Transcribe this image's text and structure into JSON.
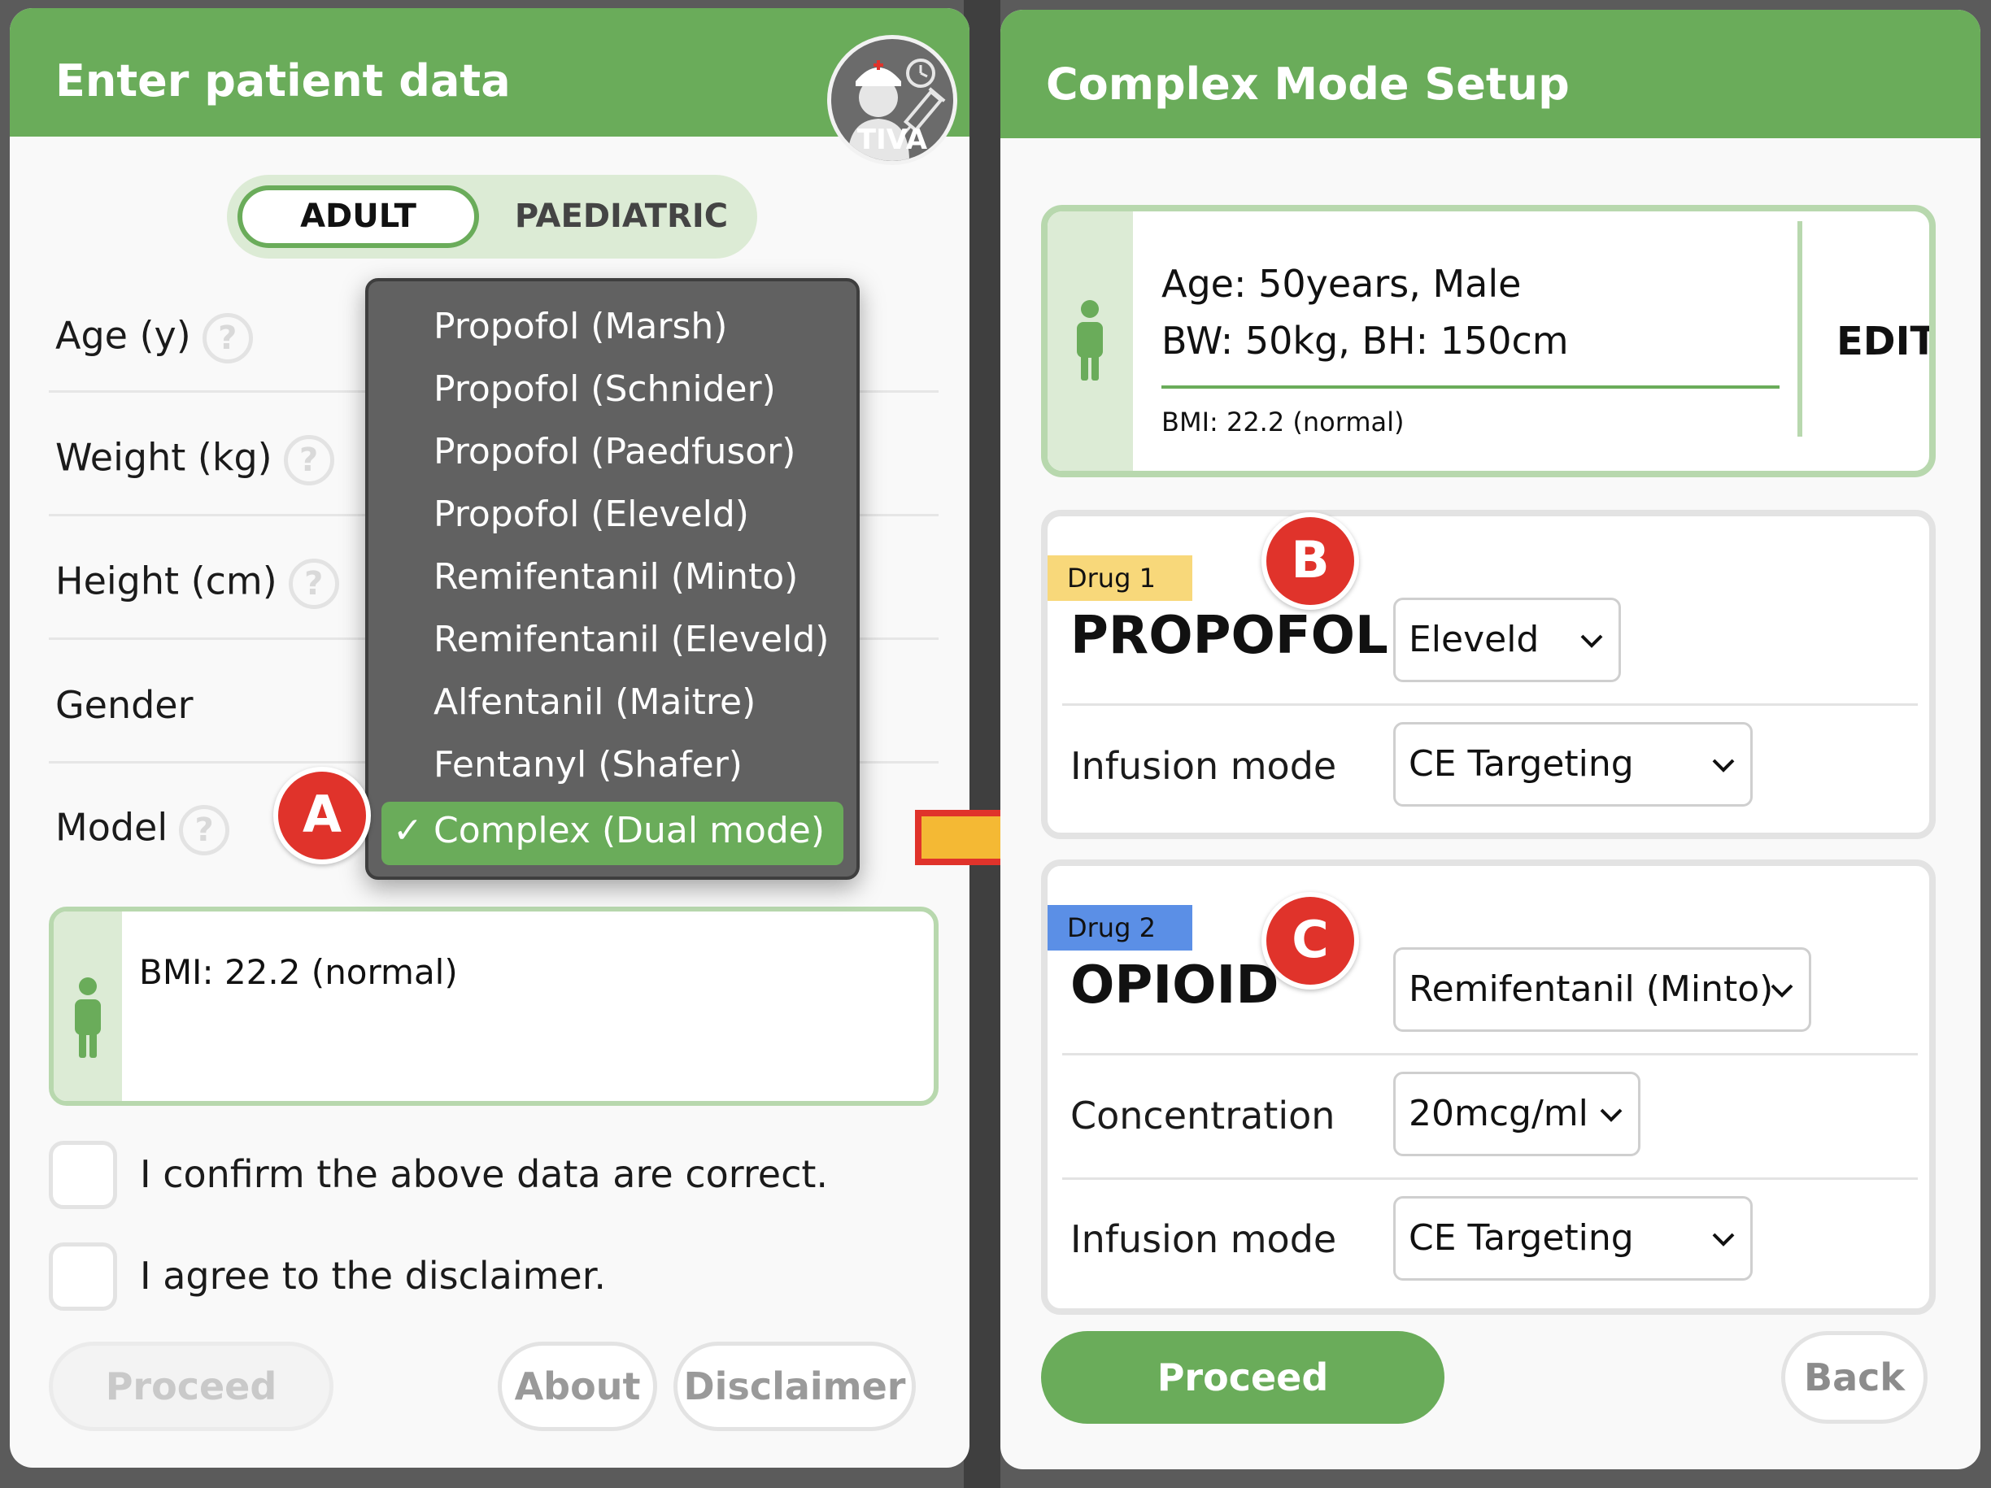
{
  "left": {
    "header_title": "Enter patient data",
    "logo_text": "TIVA",
    "toggle": {
      "adult": "ADULT",
      "paediatric": "PAEDIATRIC"
    },
    "fields": {
      "age": "Age (y)",
      "weight": "Weight (kg)",
      "height": "Height (cm)",
      "gender": "Gender",
      "model": "Model"
    },
    "help_glyph": "?",
    "model_dropdown": {
      "options": [
        "Propofol (Marsh)",
        "Propofol (Schnider)",
        "Propofol (Paedfusor)",
        "Propofol (Eleveld)",
        "Remifentanil (Minto)",
        "Remifentanil (Eleveld)",
        "Alfentanil (Maitre)",
        "Fentanyl (Shafer)"
      ],
      "selected": "Complex (Dual mode)",
      "check": "✓"
    },
    "bmi": "BMI: 22.2 (normal)",
    "confirm_label": "I confirm the above data are correct.",
    "disclaimer_label": "I agree to the disclaimer.",
    "buttons": {
      "proceed": "Proceed",
      "about": "About",
      "disclaimer": "Disclaimer"
    }
  },
  "badges": {
    "a": "A",
    "b": "B",
    "c": "C"
  },
  "right": {
    "header_title": "Complex Mode Setup",
    "summary": {
      "line1": "Age: 50years, Male",
      "line2": "BW: 50kg, BH: 150cm",
      "bmi": "BMI: 22.2 (normal)",
      "edit": "EDIT"
    },
    "drug1": {
      "tag": "Drug 1",
      "name": "PROPOFOL",
      "model": "Eleveld",
      "infusion_label": "Infusion mode",
      "infusion_value": "CE Targeting"
    },
    "drug2": {
      "tag": "Drug 2",
      "name": "OPIOID",
      "model": "Remifentanil (Minto)",
      "concentration_label": "Concentration",
      "concentration_value": "20mcg/ml",
      "infusion_label": "Infusion mode",
      "infusion_value": "CE Targeting"
    },
    "buttons": {
      "proceed": "Proceed",
      "back": "Back"
    }
  },
  "colors": {
    "brand_green": "#6aac5a",
    "light_green": "#dcebd5",
    "badge_red": "#e0332b",
    "drug1_tag": "#f8d87a",
    "drug2_tag": "#5b8fe6",
    "arrow": "#f4b934"
  }
}
